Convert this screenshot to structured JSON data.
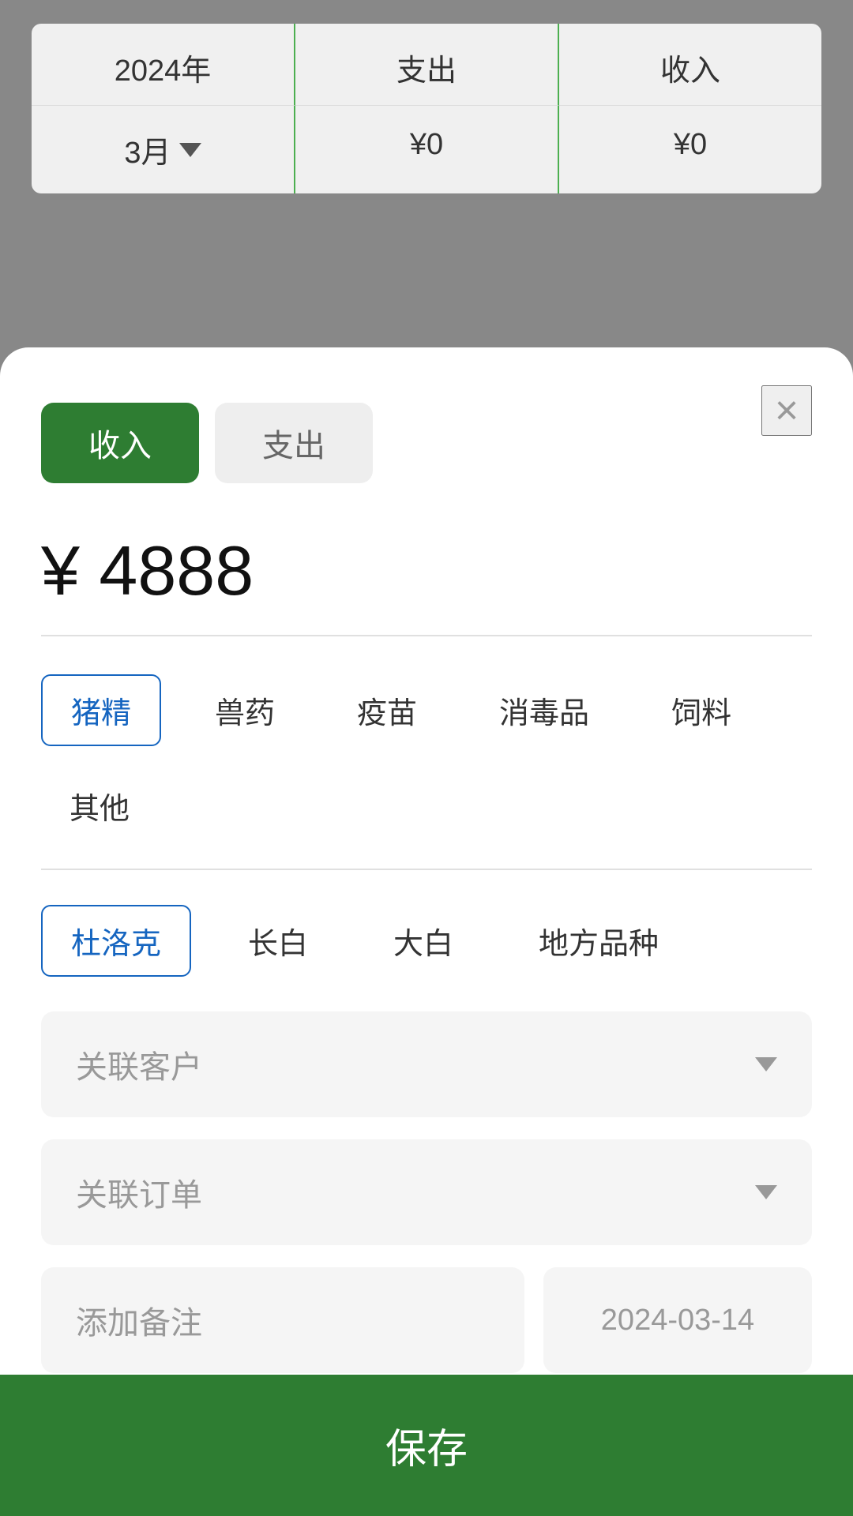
{
  "header": {
    "year": "2024年",
    "month": "3月",
    "expenditure_label": "支出",
    "income_label": "收入",
    "expenditure_value": "¥0",
    "income_value": "¥0"
  },
  "modal": {
    "close_label": "×",
    "tab_income": "收入",
    "tab_expenditure": "支出",
    "amount": "¥ 4888",
    "categories": [
      {
        "label": "猪精",
        "selected": true
      },
      {
        "label": "兽药",
        "selected": false
      },
      {
        "label": "疫苗",
        "selected": false
      },
      {
        "label": "消毒品",
        "selected": false
      },
      {
        "label": "饲料",
        "selected": false
      },
      {
        "label": "其他",
        "selected": false
      }
    ],
    "subcategories": [
      {
        "label": "杜洛克",
        "selected": true
      },
      {
        "label": "长白",
        "selected": false
      },
      {
        "label": "大白",
        "selected": false
      },
      {
        "label": "地方品种",
        "selected": false
      }
    ],
    "customer_placeholder": "关联客户",
    "order_placeholder": "关联订单",
    "note_placeholder": "添加备注",
    "date": "2024-03-14",
    "save_label": "保存"
  }
}
